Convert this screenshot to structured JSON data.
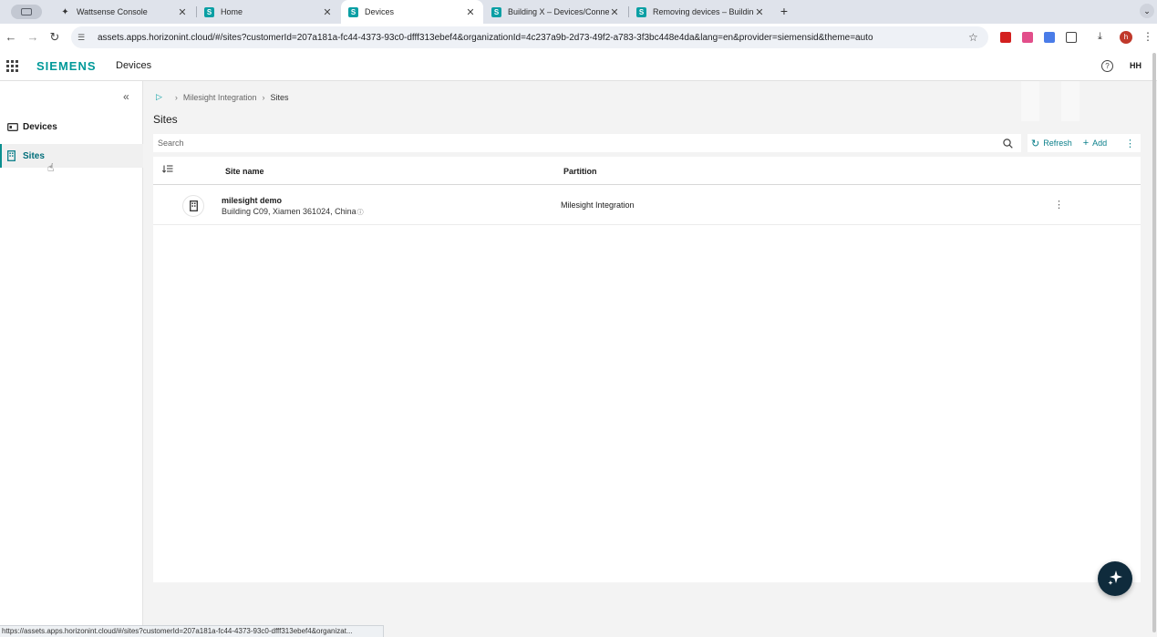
{
  "browser": {
    "tabs": [
      {
        "title": "Wattsense Console",
        "favicon": "wattsense-icon"
      },
      {
        "title": "Home",
        "favicon": "s-icon"
      },
      {
        "title": "Devices",
        "favicon": "s-icon",
        "active": true
      },
      {
        "title": "Building X – Devices/Connecti",
        "favicon": "s-icon"
      },
      {
        "title": "Removing devices – Building",
        "favicon": "s-icon"
      }
    ],
    "url": "assets.apps.horizonint.cloud/#/sites?customerId=207a181a-fc44-4373-93c0-dfff313ebef4&organizationId=4c237a9b-2d73-49f2-a783-3f3bc448e4da&lang=en&provider=siemensid&theme=auto",
    "status_url": "https://assets.apps.horizonint.cloud/#/sites?customerId=207a181a-fc44-4373-93c0-dfff313ebef4&organizat...",
    "profile_initial": "h"
  },
  "app": {
    "logo": "SIEMENS",
    "name": "Devices",
    "user_initials": "HH",
    "help_glyph": "?"
  },
  "sidebar": {
    "items": [
      {
        "label": "Devices",
        "icon": "devices-icon"
      },
      {
        "label": "Sites",
        "icon": "building-icon",
        "active": true
      }
    ]
  },
  "breadcrumb": {
    "items": [
      "Milesight Integration",
      "Sites"
    ]
  },
  "page": {
    "title": "Sites",
    "search_placeholder": "Search",
    "refresh_label": "Refresh",
    "add_label": "Add"
  },
  "table": {
    "columns": [
      "Site name",
      "Partition"
    ],
    "rows": [
      {
        "name": "milesight demo",
        "address": "Building C09, Xiamen 361024, China",
        "partition": "Milesight Integration"
      }
    ]
  },
  "colors": {
    "brand": "#009999",
    "accent": "#0a7f8a",
    "fab": "#0f2b3c"
  }
}
